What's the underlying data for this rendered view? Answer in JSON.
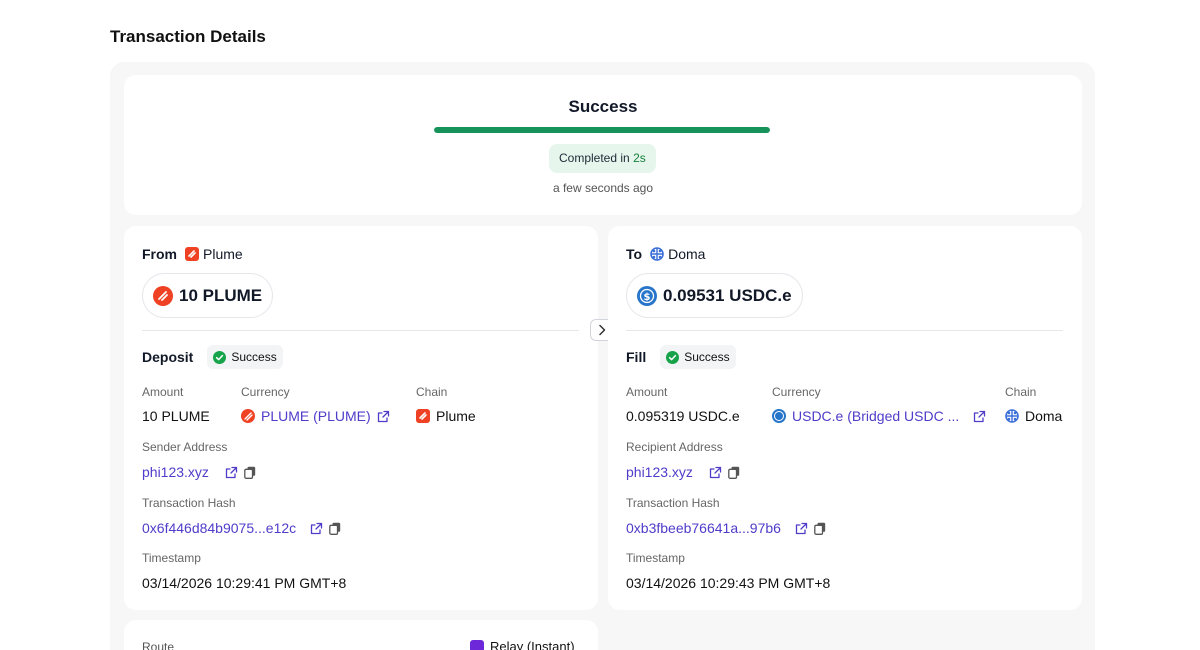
{
  "page": {
    "title": "Transaction Details"
  },
  "status": {
    "title": "Success",
    "progress_percent": 100,
    "completed_prefix": "Completed in",
    "completed_value": "2s",
    "ago": "a few seconds ago"
  },
  "from": {
    "label": "From",
    "chain": "Plume",
    "amount": "10 PLUME",
    "section": "Deposit",
    "status": "Success",
    "amount_label": "Amount",
    "amount_value": "10 PLUME",
    "currency_label": "Currency",
    "currency_value": "PLUME (PLUME)",
    "chain_label": "Chain",
    "chain_value": "Plume",
    "address_label": "Sender Address",
    "address_value": "phi123.xyz",
    "hash_label": "Transaction Hash",
    "hash_value": "0x6f446d84b9075...e12c",
    "timestamp_label": "Timestamp",
    "timestamp_value": "03/14/2026 10:29:41 PM GMT+8"
  },
  "to": {
    "label": "To",
    "chain": "Doma",
    "amount": "0.09531 USDC.e",
    "section": "Fill",
    "status": "Success",
    "amount_label": "Amount",
    "amount_value": "0.095319 USDC.e",
    "currency_label": "Currency",
    "currency_value": "USDC.e (Bridged USDC ...",
    "chain_label": "Chain",
    "chain_value": "Doma",
    "address_label": "Recipient Address",
    "address_value": "phi123.xyz",
    "hash_label": "Transaction Hash",
    "hash_value": "0xb3fbeeb76641a...97b6",
    "timestamp_label": "Timestamp",
    "timestamp_value": "03/14/2026 10:29:43 PM GMT+8"
  },
  "route": {
    "label": "Route",
    "value": "Relay (Instant)"
  },
  "colors": {
    "success_green": "#15935b",
    "link_purple": "#4f3cc9",
    "plume_red": "#ef4123",
    "usdc_blue": "#2775ca",
    "doma_blue": "#3b6fd8"
  },
  "icons": [
    "plume-icon",
    "doma-icon",
    "usdc-icon",
    "check-circle-icon",
    "external-link-icon",
    "copy-icon",
    "chevron-right-icon",
    "relay-icon"
  ]
}
